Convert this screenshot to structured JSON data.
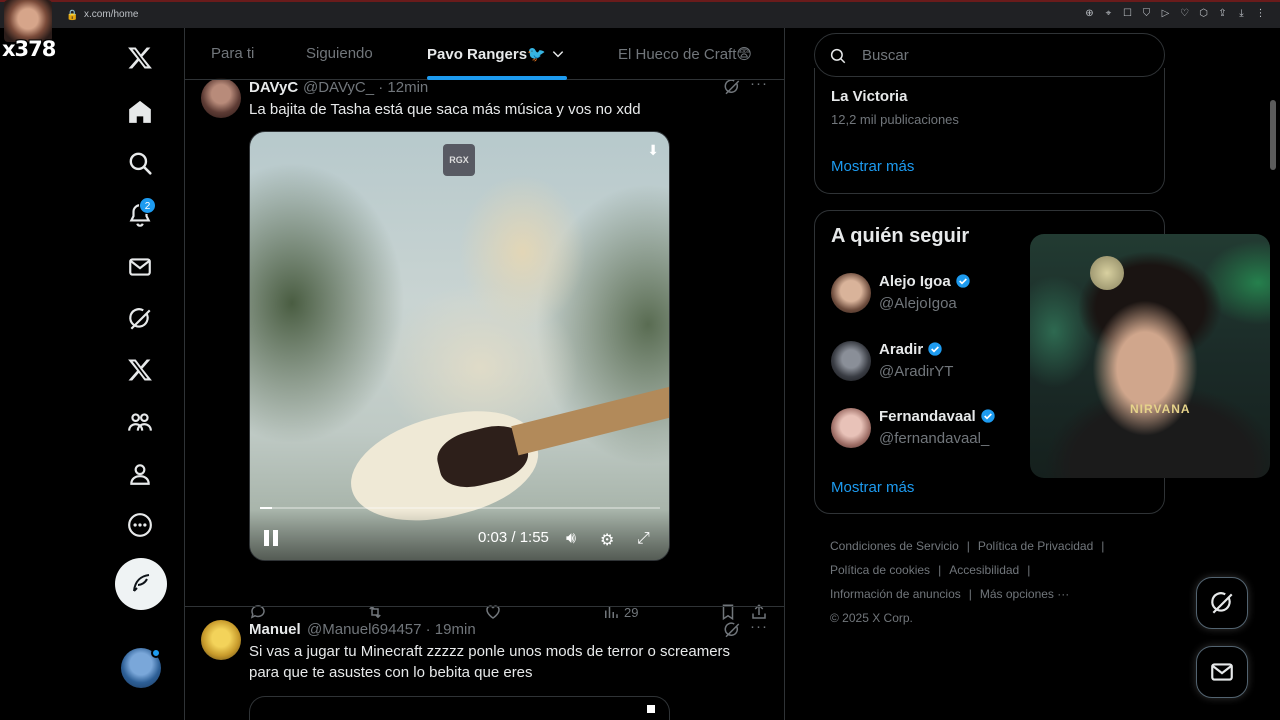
{
  "browser": {
    "url": "x.com/home"
  },
  "overlay": {
    "badge_text": "x378"
  },
  "nav": {
    "items": [
      {
        "name": "x-logo-icon"
      },
      {
        "name": "home-icon"
      },
      {
        "name": "search-icon"
      },
      {
        "name": "notifications-icon"
      },
      {
        "name": "messages-icon"
      },
      {
        "name": "grok-icon"
      },
      {
        "name": "premium-x-icon"
      },
      {
        "name": "communities-icon"
      },
      {
        "name": "profile-icon"
      },
      {
        "name": "more-icon"
      }
    ],
    "notification_count": "2"
  },
  "tabs": [
    {
      "label": "Para ti"
    },
    {
      "label": "Siguiendo"
    },
    {
      "label": "Pavo Rangers🐦"
    },
    {
      "label": "El Hueco de Craft😨"
    }
  ],
  "tweets": [
    {
      "name": "DAVyC",
      "handle": "@DAVyC_ · 12min",
      "text": "La bajita de Tasha está que saca más música y vos no xdd",
      "media": {
        "watermark": "RGX",
        "time": "0:03 / 1:55",
        "progress": 0.03
      },
      "stats": {
        "views": "29"
      }
    },
    {
      "name": "Manuel",
      "handle": "@Manuel694457 · 19min",
      "text_line1": "Si vas a jugar tu Minecraft zzzzz ponle unos mods de terror o screamers",
      "text_line2": "para que te asustes con lo bebita que eres"
    }
  ],
  "sidebar": {
    "search_placeholder": "Buscar",
    "trend": {
      "name": "La Victoria",
      "count": "12,2 mil publicaciones",
      "show_more": "Mostrar más"
    },
    "who_to_follow": {
      "title": "A quién seguir",
      "users": [
        {
          "name": "Alejo Igoa",
          "handle": "@AlejoIgoa"
        },
        {
          "name": "Aradir",
          "handle": "@AradirYT"
        },
        {
          "name": "Fernandavaal",
          "handle": "@fernandavaal_"
        }
      ],
      "show_more": "Mostrar más"
    },
    "footer": {
      "terms": "Condiciones de Servicio",
      "privacy": "Política de Privacidad",
      "cookies": "Política de cookies",
      "accessibility": "Accesibilidad",
      "ads": "Información de anuncios",
      "more": "Más opciones ···",
      "copyright": "© 2025 X Corp."
    }
  },
  "webcam": {
    "shirt_text": "NIRVANA"
  }
}
